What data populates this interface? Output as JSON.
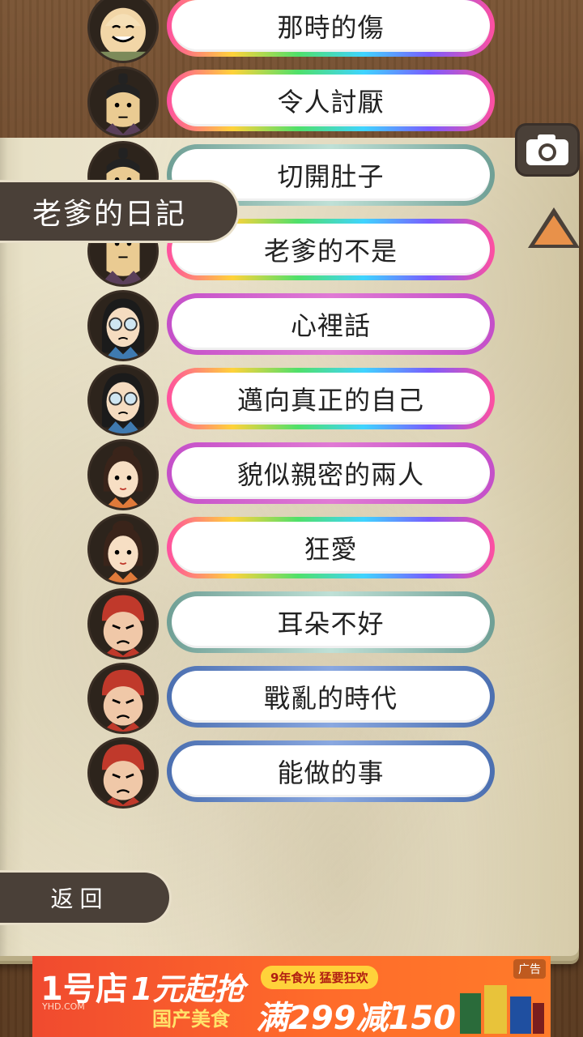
{
  "diary": {
    "title": "老爹的日記"
  },
  "entries": [
    {
      "label": "那時的傷"
    },
    {
      "label": "令人討厭"
    },
    {
      "label": "切開肚子"
    },
    {
      "label": "老爹的不是"
    },
    {
      "label": "心裡話"
    },
    {
      "label": "邁向真正的自己"
    },
    {
      "label": "貌似親密的兩人"
    },
    {
      "label": "狂愛"
    },
    {
      "label": "耳朵不好"
    },
    {
      "label": "戰亂的時代"
    },
    {
      "label": "能做的事"
    }
  ],
  "back": {
    "label": "返回"
  },
  "ad": {
    "logo": "1号店",
    "logo_sub": "YHD.COM",
    "headline": "1元起抢",
    "subline": "国产美食",
    "badge": "9年食光 猛要狂欢",
    "promo": "满299减150",
    "tag": "广告"
  },
  "colors": {
    "panel": "#4a4038",
    "up_arrow": "#e8914a",
    "ad_bg": "#f04a2f"
  },
  "icons": {
    "camera": "camera-icon",
    "up": "triangle-up-icon"
  }
}
